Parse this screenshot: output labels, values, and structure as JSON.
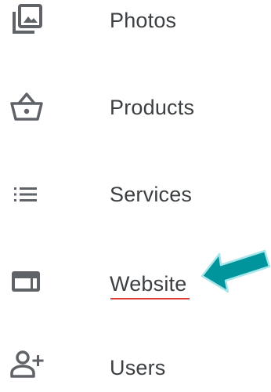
{
  "nav": {
    "items": [
      {
        "label": "Photos",
        "icon": "photo-library-icon"
      },
      {
        "label": "Products",
        "icon": "basket-icon"
      },
      {
        "label": "Services",
        "icon": "list-icon"
      },
      {
        "label": "Website",
        "icon": "web-icon"
      },
      {
        "label": "Users",
        "icon": "person-add-icon"
      }
    ]
  },
  "annotation": {
    "highlighted_item": "Website",
    "underline_color": "#e53935",
    "arrow_color": "#00959c",
    "arrow_direction": "pointing-left"
  },
  "colors": {
    "text": "#3c4043",
    "icon": "#5f6368"
  }
}
